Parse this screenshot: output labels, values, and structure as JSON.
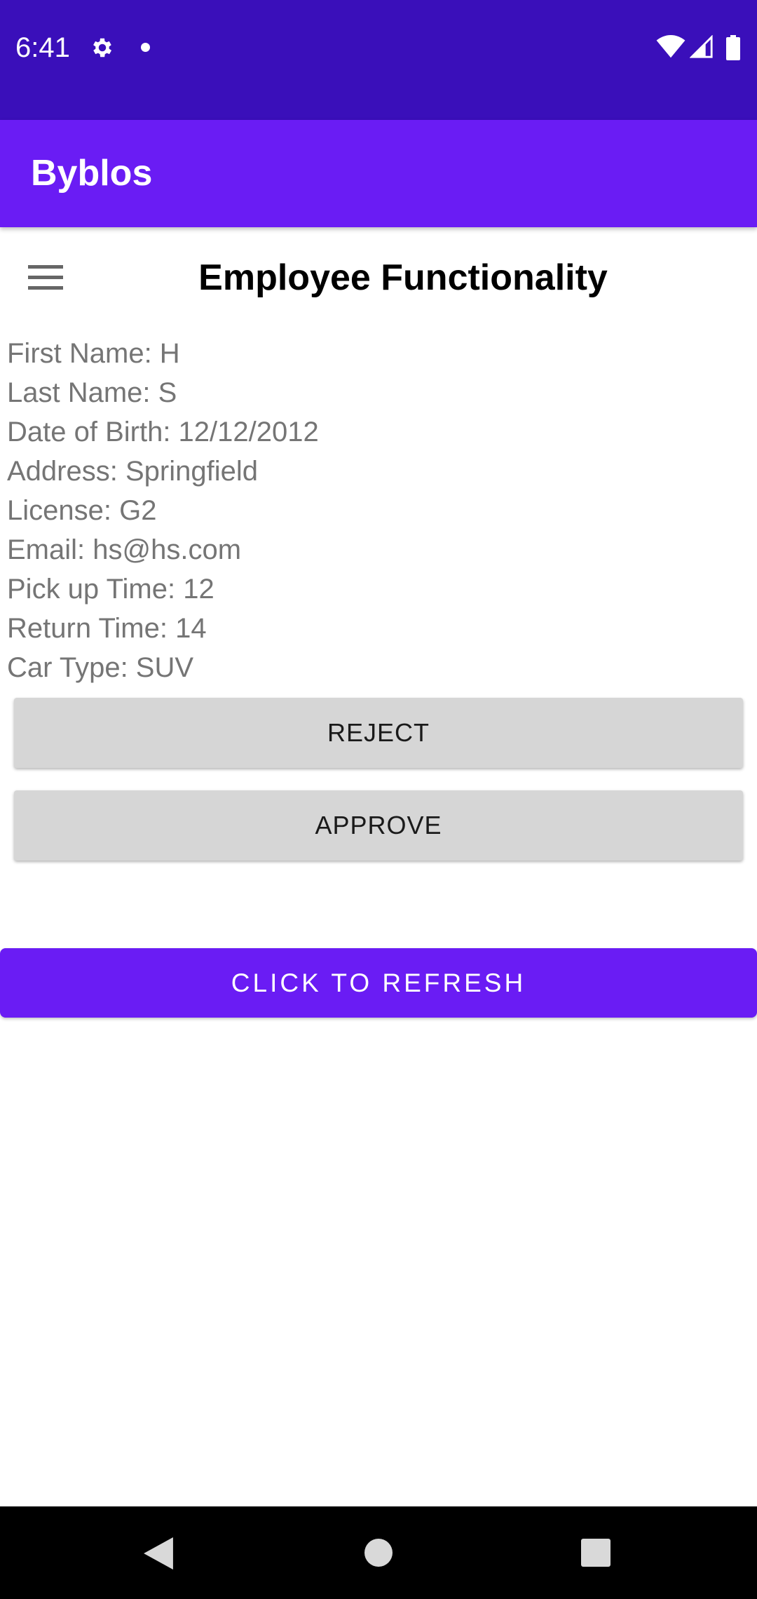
{
  "status_bar": {
    "time": "6:41",
    "icons": [
      "gear-icon",
      "notification-dot-icon",
      "wifi-icon",
      "cell-signal-icon",
      "battery-icon"
    ]
  },
  "app_bar": {
    "title": "Byblos"
  },
  "page": {
    "title": "Employee Functionality",
    "menu_icon": "hamburger-menu-icon"
  },
  "request_details": [
    "First Name: H",
    "Last Name: S",
    "Date of Birth: 12/12/2012",
    "Address: Springfield",
    "License: G2",
    "Email: hs@hs.com",
    "Pick up Time: 12",
    "Return Time: 14",
    "Car Type: SUV"
  ],
  "buttons": {
    "reject": "REJECT",
    "approve": "APPROVE",
    "refresh": "CLICK TO REFRESH"
  },
  "colors": {
    "status_bar": "#3a0fba",
    "app_bar": "#6a1cf4",
    "primary_button": "#6a1cf4",
    "secondary_button": "#d6d6d6"
  },
  "nav_bar": {
    "icons": [
      "back-icon",
      "home-icon",
      "recents-icon"
    ]
  }
}
